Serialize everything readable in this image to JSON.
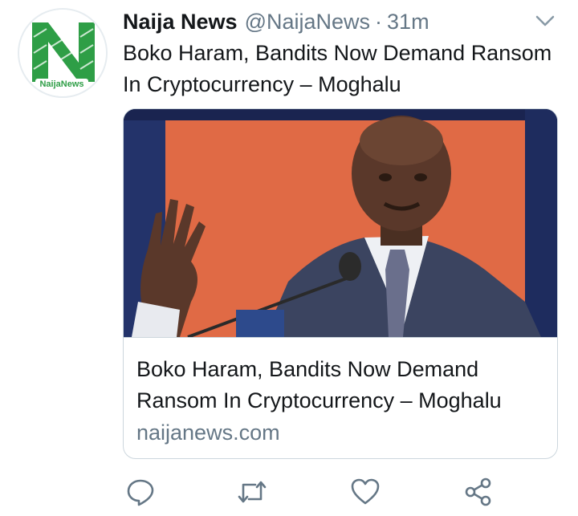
{
  "tweet": {
    "author_name": "Naija News",
    "author_handle": "@NaijaNews",
    "separator": "·",
    "timestamp": "31m",
    "text": "Boko Haram, Bandits Now Demand Ransom In Cryptocurrency – Moghalu",
    "avatar_logo_text": "NaijaNews"
  },
  "card": {
    "title": "Boko Haram, Bandits Now Demand Ransom In Cryptocurrency – Moghalu",
    "domain": "naijanews.com"
  },
  "actions": {
    "icons": [
      "reply-icon",
      "retweet-icon",
      "like-icon",
      "share-icon"
    ]
  },
  "colors": {
    "text_primary": "#14171a",
    "text_secondary": "#657786",
    "icon": "#657786",
    "border": "#ccd6dd",
    "logo_green": "#2e9e46"
  }
}
